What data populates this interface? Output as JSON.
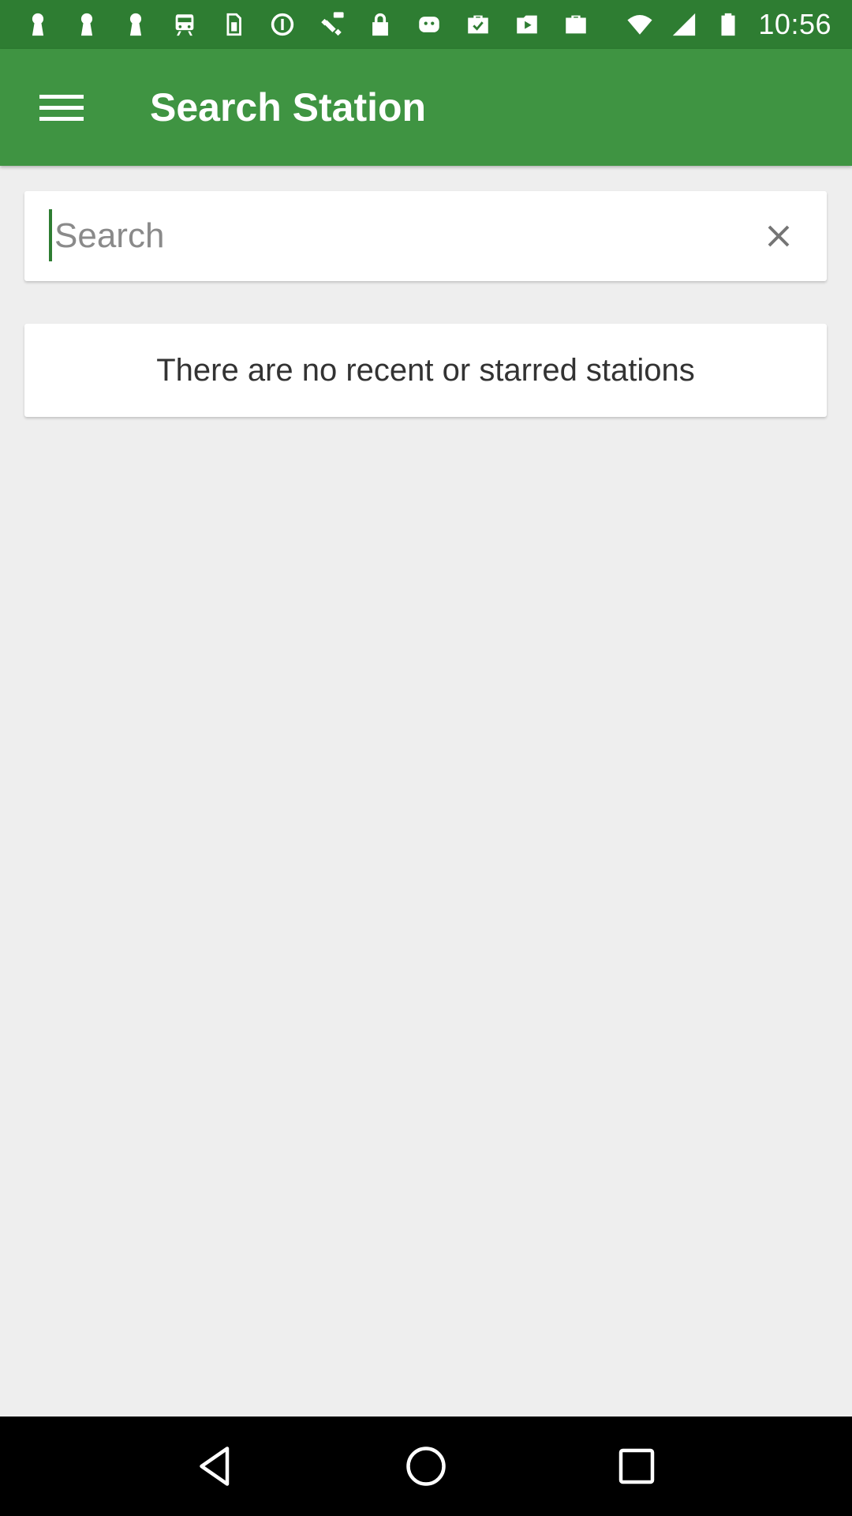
{
  "status_bar": {
    "time": "10:56",
    "icons": [
      "keyhole-icon",
      "keyhole-icon",
      "keyhole-icon",
      "train-icon",
      "sim-icon",
      "alert-circle-icon",
      "fake-gps-icon",
      "lock-icon",
      "android-icon",
      "briefcase-check-icon",
      "play-store-icon",
      "briefcase-icon"
    ]
  },
  "app_bar": {
    "title": "Search Station",
    "menu_icon": "hamburger-menu-icon",
    "background_color": "#3f9442"
  },
  "search": {
    "placeholder": "Search",
    "value": "",
    "clear_icon": "close-icon"
  },
  "empty_state": {
    "message": "There are no recent or starred stations"
  },
  "nav_bar": {
    "icons": [
      "back-icon",
      "home-icon",
      "recents-icon"
    ]
  }
}
